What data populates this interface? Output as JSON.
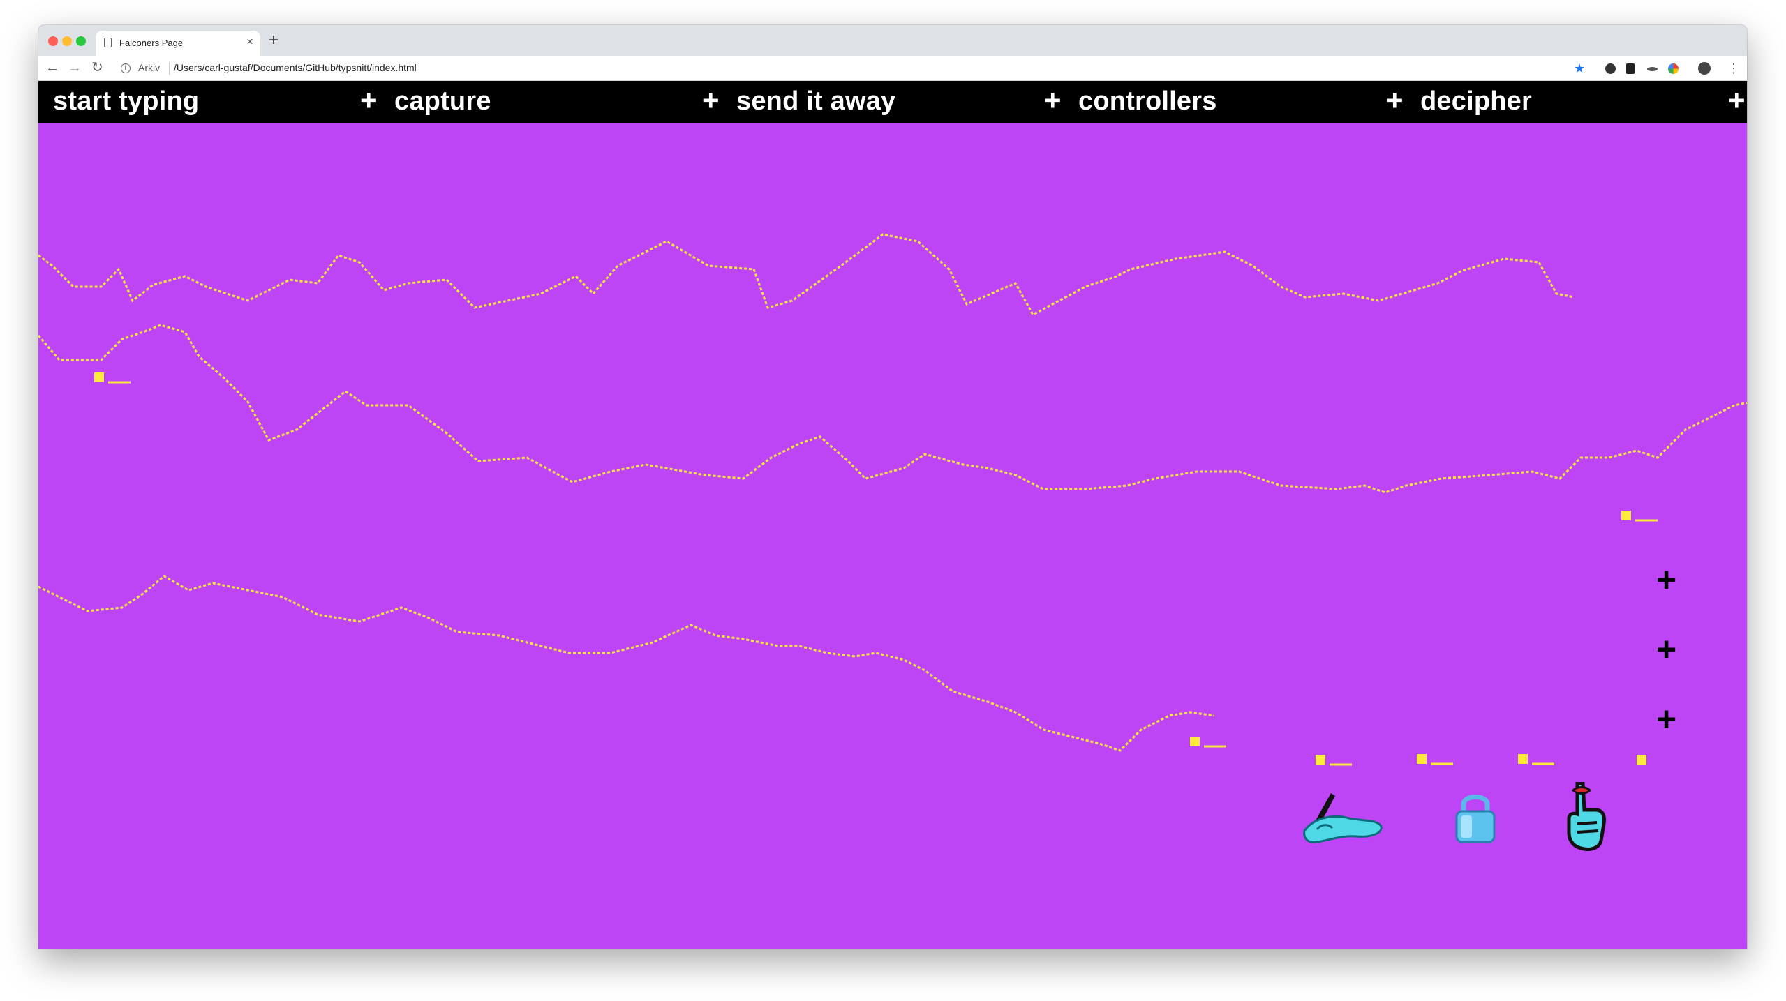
{
  "browser": {
    "tab_title": "Falconers Page",
    "new_tab": "+",
    "tab_close": "×",
    "back": "←",
    "forward": "→",
    "reload": "↻",
    "info": "i",
    "site_label": "Arkiv",
    "url": "/Users/carl-gustaf/Documents/GitHub/typsnitt/index.html",
    "bookmark_star": "★",
    "menu_dots": "⋮",
    "colors": {
      "close": "#ff5f57",
      "minimize": "#febc2e",
      "maximize": "#28c840",
      "star": "#1a73e8"
    }
  },
  "menu": {
    "items": [
      "start typing",
      "capture",
      "send it away",
      "controllers",
      "decipher"
    ],
    "plus": "+"
  },
  "page": {
    "background": "#bd45f5",
    "line_color": "#ffe93b",
    "side_plus": [
      "+",
      "+",
      "+"
    ]
  },
  "tools": {
    "icons": [
      "writing-hand-icon",
      "padlock-icon",
      "shushing-hand-icon"
    ]
  }
}
